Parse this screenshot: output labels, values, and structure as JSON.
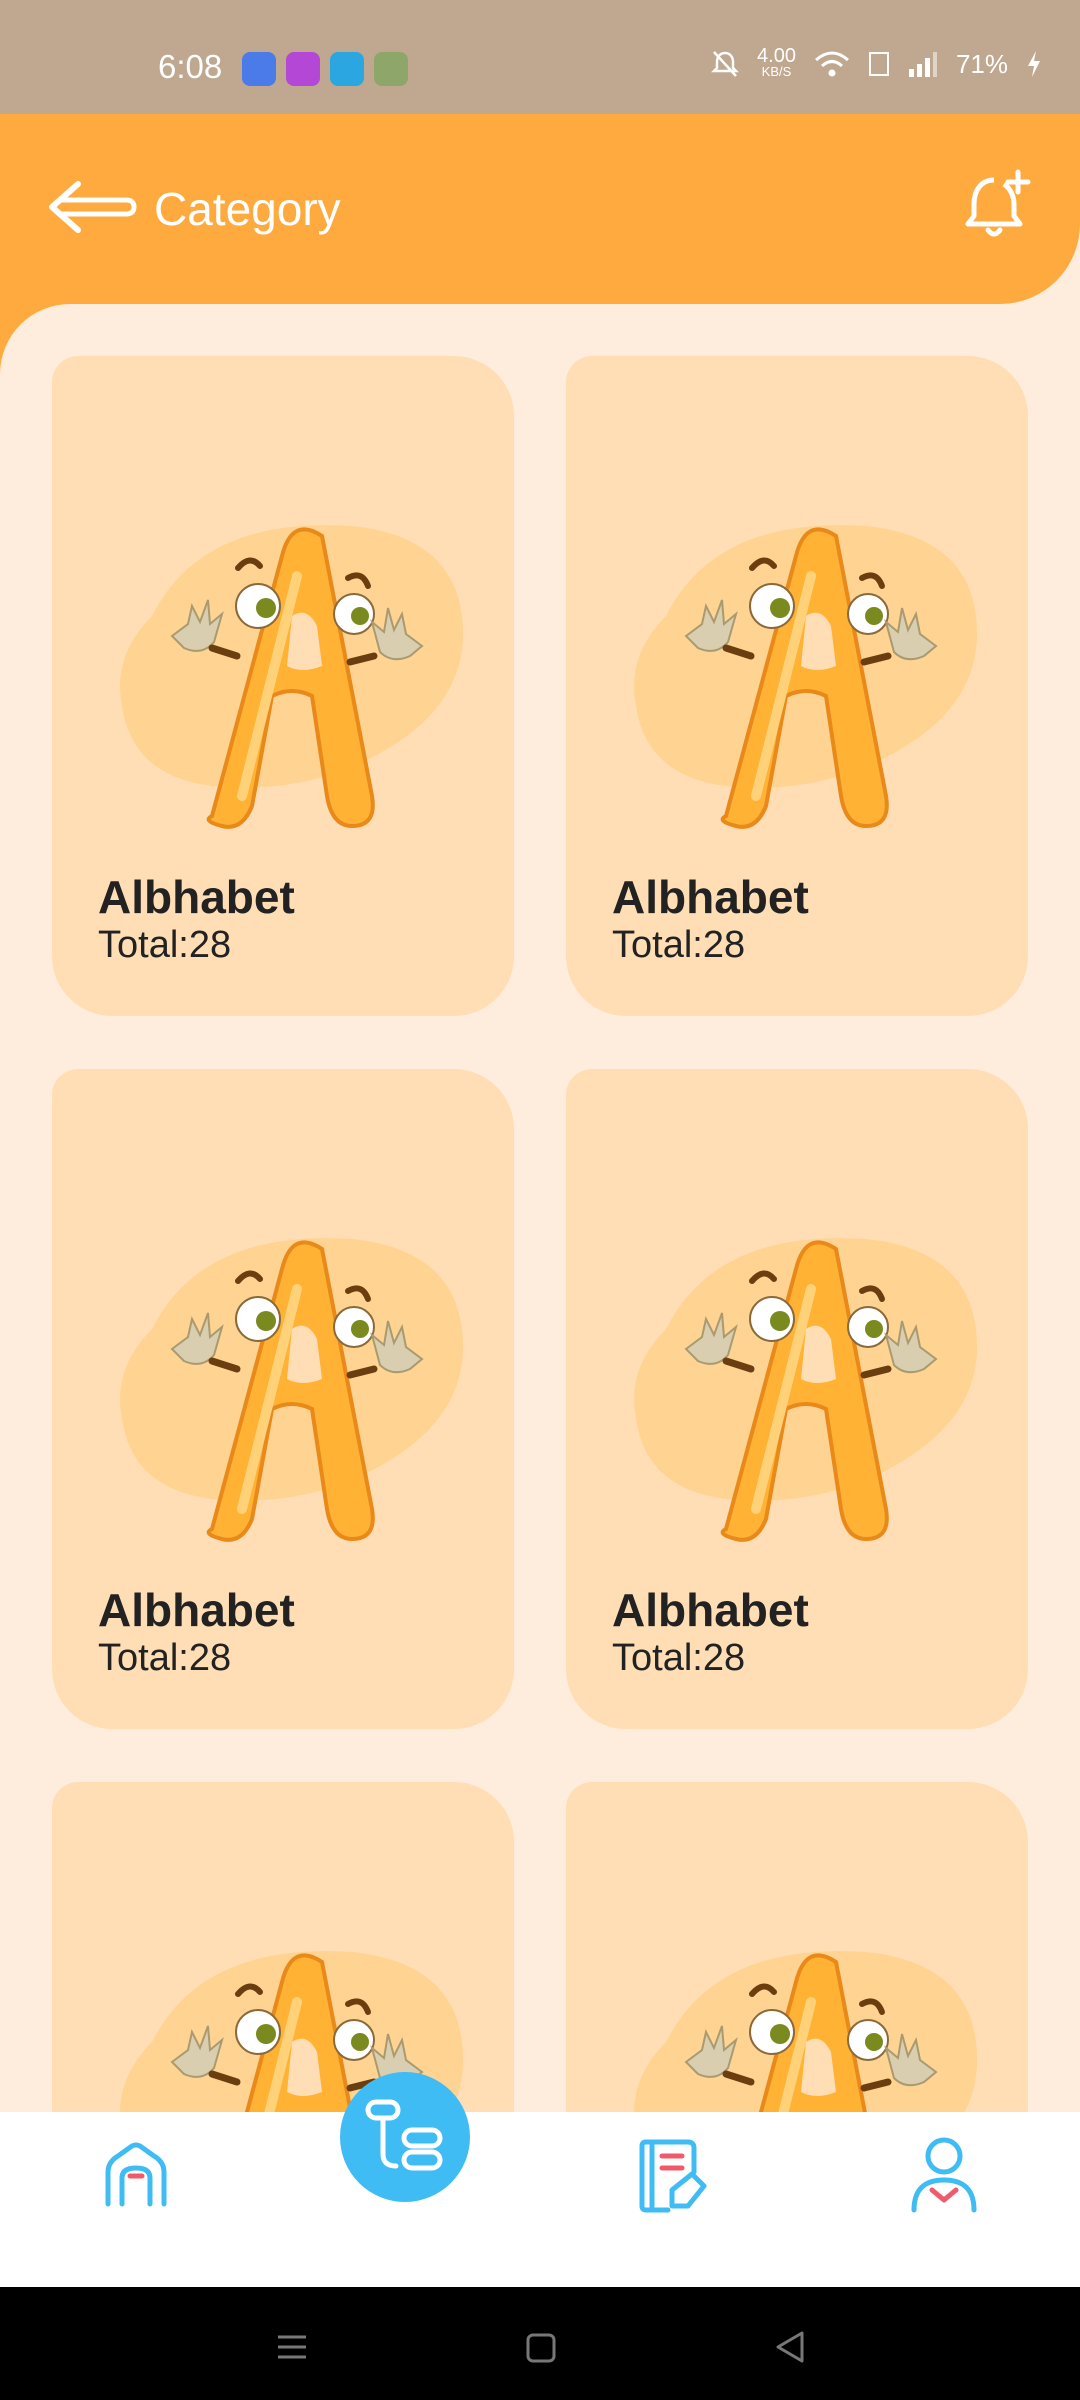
{
  "status_bar": {
    "time": "6:08",
    "net_speed": "4.00",
    "net_unit": "KB/S",
    "battery": "71%"
  },
  "header": {
    "title": "Category"
  },
  "cards": [
    {
      "title": "Albhabet",
      "count": "Total:28"
    },
    {
      "title": "Albhabet",
      "count": "Total:28"
    },
    {
      "title": "Albhabet",
      "count": "Total:28"
    },
    {
      "title": "Albhabet",
      "count": "Total:28"
    },
    {
      "title": "",
      "count": ""
    },
    {
      "title": "",
      "count": ""
    }
  ],
  "colors": {
    "header": "#FFAA3F",
    "background": "#FEEDDC",
    "card": "#FFDEB5",
    "fab": "#40BCF5",
    "nav_icon": "#40BCF5"
  },
  "icons": {
    "back": "arrow-left-icon",
    "notification": "bell-plus-icon",
    "home": "home-icon",
    "fab": "apps-icon",
    "lessons": "book-edit-icon",
    "profile": "user-icon"
  }
}
